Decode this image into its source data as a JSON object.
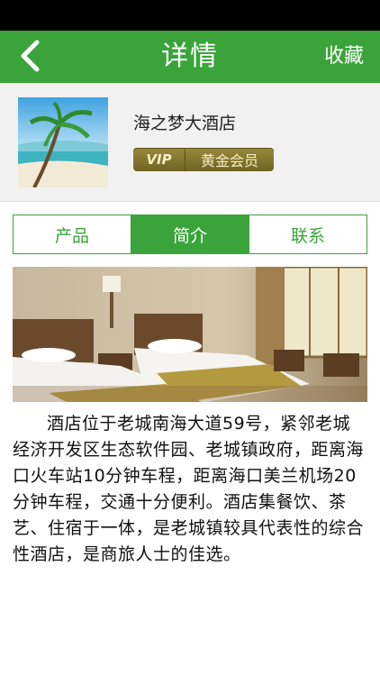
{
  "header": {
    "back_icon": "chevron-left-icon",
    "title": "详情",
    "favorite_label": "收藏"
  },
  "hotel": {
    "name": "海之梦大酒店",
    "vip_tag": "VIP",
    "member_level": "黄金会员"
  },
  "tabs": [
    {
      "label": "产品",
      "active": false
    },
    {
      "label": "简介",
      "active": true
    },
    {
      "label": "联系",
      "active": false
    }
  ],
  "description": "酒店位于老城南海大道59号，紧邻老城经济开发区生态软件园、老城镇政府，距离海口火车站10分钟车程，距离海口美兰机场20分钟车程，交通十分便利。酒店集餐饮、茶艺、住宿于一体，是老城镇较具代表性的综合性酒店，是商旅人士的佳选。",
  "colors": {
    "primary": "#3aa43a",
    "status_bar": "#000000",
    "vip_gold": "#9a8a3c"
  }
}
